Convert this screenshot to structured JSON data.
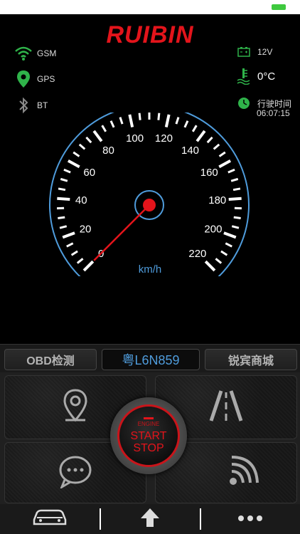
{
  "brand": "RUIBIN",
  "signals": {
    "gsm_label": "GSM",
    "gps_label": "GPS",
    "bt_label": "BT"
  },
  "vehicle": {
    "voltage": "12V",
    "temperature": "0°C",
    "drive_time_label": "行驶时间",
    "drive_time": "06:07:15"
  },
  "speedometer": {
    "speed": 0,
    "unit": "km/h",
    "min": 0,
    "max": 220,
    "tick_labels": [
      "0",
      "20",
      "40",
      "60",
      "80",
      "100",
      "120",
      "140",
      "160",
      "180",
      "200",
      "220"
    ]
  },
  "tabs": {
    "obd": "OBD检测",
    "plate": "粤L6N859",
    "shop": "锐宾商城"
  },
  "start_button": {
    "engine": "ENGINE",
    "start": "START",
    "stop": "STOP"
  },
  "icons": {
    "gsm": "wifi-signal-icon",
    "gps": "location-pin-icon",
    "bt": "bluetooth-icon",
    "battery": "battery-icon",
    "coolant": "coolant-temperature-icon",
    "clock": "clock-icon",
    "location": "location-pin-icon",
    "road": "road-icon",
    "message": "chat-bubble-icon",
    "signal": "signal-waves-icon",
    "car": "car-icon",
    "home": "up-arrow-icon",
    "more": "more-dots-icon"
  },
  "colors": {
    "brand": "#e3141b",
    "accent_blue": "#4f9cdc",
    "signal_green": "#2fb34a"
  }
}
